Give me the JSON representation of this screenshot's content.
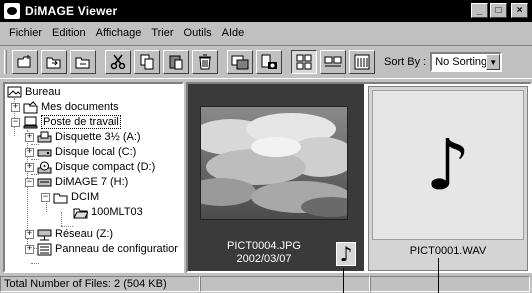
{
  "window": {
    "title": "DiMAGE Viewer",
    "minimize_label": "_",
    "maximize_label": "□",
    "close_label": "×"
  },
  "menu": [
    "Fichier",
    "Edition",
    "Affichage",
    "Trier",
    "Outils",
    "AIde"
  ],
  "toolbar": {
    "sort_label": "Sort By :",
    "sort_value": "No Sorting",
    "sort_arrow": "▼"
  },
  "tree": {
    "root": "Bureau",
    "my_documents": "Mes documents",
    "workstation": "Poste de travail",
    "floppy": "Disquette 3½ (A:)",
    "local_disk": "Disque local (C:)",
    "compact_disk": "Disque compact (D:)",
    "camera": "DiMAGE 7 (H:)",
    "dcim": "DCIM",
    "folder_selected": "100MLT03",
    "network": "Réseau (Z:)",
    "control_panel": "Panneau de configuratior",
    "expander_plus": "+",
    "expander_minus": "−"
  },
  "thumbnails": [
    {
      "filename": "PICT0004.JPG",
      "date": "2002/03/07",
      "badge_glyph": "♪"
    },
    {
      "filename": "PICT0001.WAV",
      "glyph": "♪"
    }
  ],
  "status": {
    "total": "Total Number of Files: 2 (504 KB)"
  },
  "colors": {
    "titlebar": "#000000",
    "window_face": "#c0c0c0",
    "selected_card": "#3a3a3a"
  }
}
